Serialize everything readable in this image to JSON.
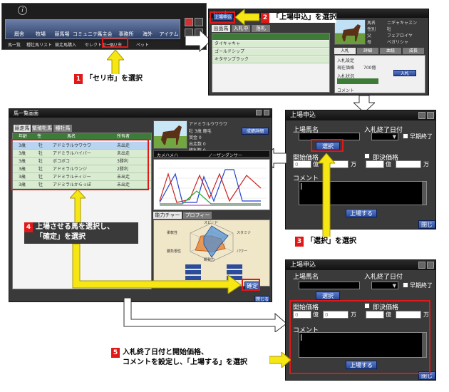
{
  "callouts": {
    "step1": {
      "num": "1",
      "text": "「セリ市」を選択"
    },
    "step2": {
      "num": "2",
      "text": "「上場申込」を選択"
    },
    "step3": {
      "num": "3",
      "text": "「選択」を選択"
    },
    "step4": {
      "num": "4",
      "line1": "上場させる馬を選択し、",
      "line2": "「確定」を選択"
    },
    "step5": {
      "num": "5",
      "line1": "入札終了日付と開始価格、",
      "line2": "コメントを設定し、「上場する」を選択"
    }
  },
  "top_menu": {
    "nav": [
      "厩舎",
      "牧場",
      "競馬場",
      "コミュニティ",
      "馬主会",
      "事務所",
      "海外",
      "アイテム"
    ],
    "sub": [
      "馬一覧",
      "種牡馬リスト",
      "競走馬購入",
      "セレクトセール",
      "セリ市",
      "ペット"
    ]
  },
  "market_window": {
    "title": "セリ市",
    "apply_button": "上場申込",
    "tabs": [
      "出品馬",
      "入札中",
      "落札"
    ],
    "rows": [
      "タイキャキャ",
      "ゴールドシップ",
      "キタサンブラック"
    ],
    "info": [
      {
        "label": "馬名",
        "value": "ニギャキャスン"
      },
      {
        "label": "性別",
        "value": "牡"
      },
      {
        "label": "父",
        "value": "フェアロイヤ"
      },
      {
        "label": "母",
        "value": "ベガリシャ"
      }
    ],
    "subtabs": [
      "入札",
      "詳細",
      "血統",
      "成長"
    ],
    "section_auction": "入札設定",
    "section_status": "入札状況",
    "section_comment": "コメント",
    "price_label": "現在価格",
    "price_value": "700億",
    "bid_button": "入札"
  },
  "apply_form": {
    "title": "上場申込",
    "horse_name_label": "上場馬名",
    "end_date_label": "入札終了日付",
    "early_end_label": "早期終了",
    "select_button": "選択",
    "start_price_label": "開始価格",
    "instant_price_label": "即決価格",
    "unit_oku": "億",
    "unit_man": "万",
    "price_value": "0",
    "comment_label": "コメント",
    "submit_button": "上場する",
    "close_button": "閉じる"
  },
  "horse_list": {
    "title": "馬一覧画面",
    "tabs": [
      "競走馬",
      "繁殖牝馬",
      "種牡馬"
    ],
    "headers": [
      "年齢",
      "性",
      "馬名",
      "所有者"
    ],
    "rows": [
      {
        "age": "3歳",
        "sex": "牡",
        "name": "アドミラルウワウワ",
        "owner": "未出走"
      },
      {
        "age": "3歳",
        "sex": "牡",
        "name": "アドミラルハイパー",
        "owner": "未出走"
      },
      {
        "age": "3歳",
        "sex": "牡",
        "name": "ボコボコ",
        "owner": "3勝利"
      },
      {
        "age": "3歳",
        "sex": "牡",
        "name": "アドミラルウンジ",
        "owner": "2勝利"
      },
      {
        "age": "3歳",
        "sex": "牡",
        "name": "アドミラルティジー",
        "owner": "未出走"
      },
      {
        "age": "3歳",
        "sex": "牡",
        "name": "アドミラルからっぽ",
        "owner": "未出走"
      }
    ],
    "detail_name": "アドミラルウワウワ",
    "detail_button": "成績詳細",
    "detail_rows": [
      "牡 3歳 鹿毛",
      "賞金 0",
      "出走数 0",
      "勝利数 0"
    ],
    "pedigree": [
      "カメハメハ",
      "ノーザンダンサー"
    ],
    "radar_tabs": [
      "能力チャート",
      "プロフィール"
    ],
    "radar_labels": [
      "スピード",
      "スタミナ",
      "パワー",
      "瞬発力",
      "勝負根性",
      "柔軟性"
    ],
    "confirm_button": "確定",
    "close_button": "閉じる"
  }
}
